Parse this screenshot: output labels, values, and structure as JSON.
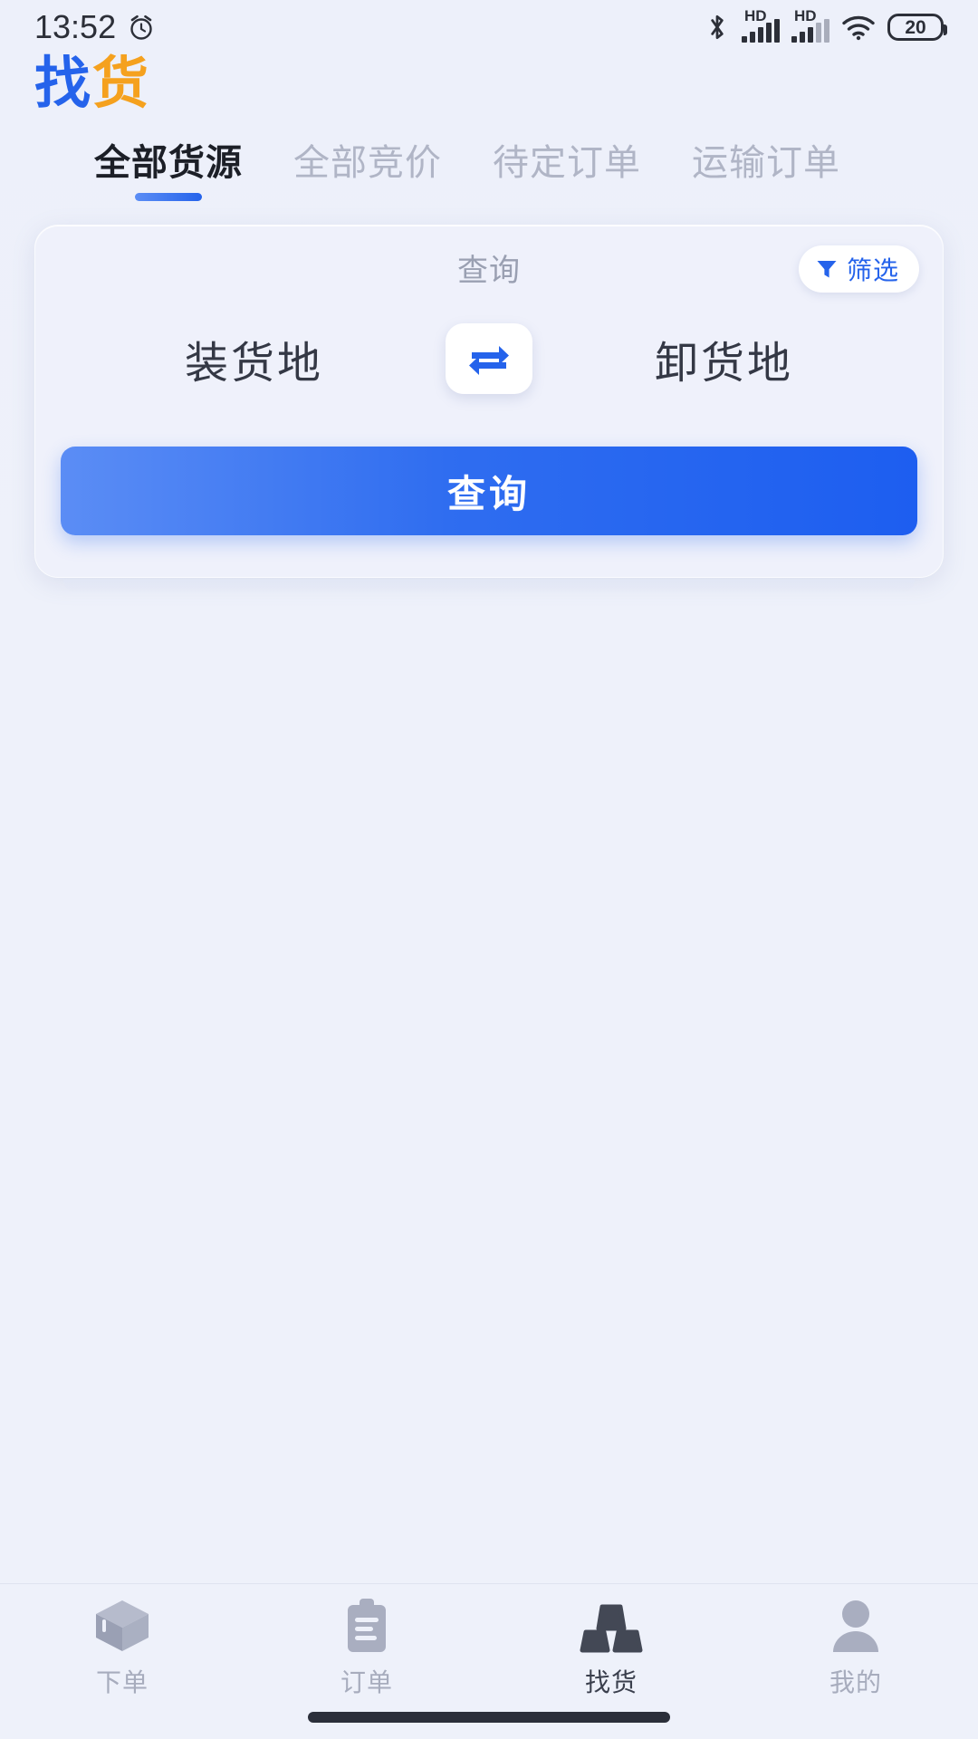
{
  "status_bar": {
    "time": "13:52",
    "alarm_icon": "alarm-clock-icon",
    "bluetooth_icon": "bluetooth-icon",
    "sim1": {
      "hd_label": "HD",
      "icon": "signal-bars-icon"
    },
    "sim2": {
      "hd_label": "HD",
      "icon": "signal-bars-icon"
    },
    "wifi_icon": "wifi-icon",
    "battery_level": "20"
  },
  "header": {
    "logo_main": "找",
    "logo_accent": "货"
  },
  "tabs": [
    {
      "label": "全部货源",
      "active": true
    },
    {
      "label": "全部竞价",
      "active": false
    },
    {
      "label": "待定订单",
      "active": false
    },
    {
      "label": "运输订单",
      "active": false
    }
  ],
  "search_card": {
    "title": "查询",
    "filter_label": "筛选",
    "filter_icon": "funnel-icon",
    "origin_placeholder": "装货地",
    "swap_icon": "swap-arrows-icon",
    "destination_placeholder": "卸货地",
    "submit_label": "查询"
  },
  "bottom_nav": [
    {
      "label": "下单",
      "icon": "box-3d-icon",
      "active": false
    },
    {
      "label": "订单",
      "icon": "clipboard-icon",
      "active": false
    },
    {
      "label": "找货",
      "icon": "cargo-stack-icon",
      "active": true
    },
    {
      "label": "我的",
      "icon": "person-icon",
      "active": false
    }
  ],
  "colors": {
    "brand_blue": "#2563eb",
    "brand_orange": "#f5a11e",
    "page_bg": "#eef1fa",
    "muted_text": "#a7acbd",
    "active_text": "#1c1f27"
  }
}
